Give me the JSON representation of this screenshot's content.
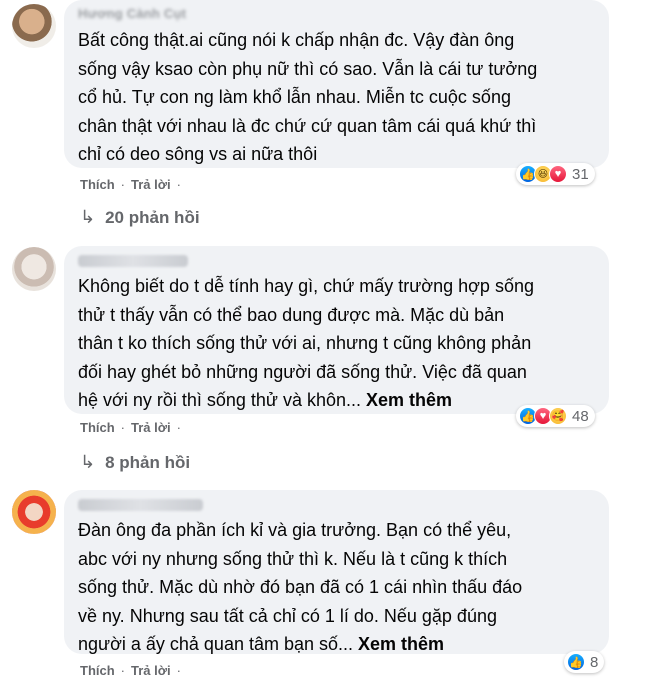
{
  "comments": [
    {
      "author": "Hương Cành Cụt",
      "text": "Bất công thật.ai cũng nói k chấp nhận đc. Vậy đàn ông\nsống vậy ksao còn phụ nữ thì có sao. Vẫn là cái tư tưởng\ncổ hủ. Tự con ng làm khổ lẫn nhau. Miễn tc cuộc sống\nchân thật với nhau là đc chứ cứ quan tâm cái quá khứ thì\nchỉ có deo sông vs ai nữa thôi",
      "see_more": "",
      "reaction_icons": [
        "like-icon",
        "haha-icon",
        "love-icon"
      ],
      "reaction_count": "31",
      "like_label": "Thích",
      "reply_label": "Trả lời",
      "replies_label": "20 phản hồi"
    },
    {
      "author": "",
      "text": "Không biết do t dễ tính hay gì, chứ mấy trường hợp sống\nthử t thấy vẫn có thể bao dung được mà. Mặc dù bản\nthân t ko thích sống thử với ai, nhưng t cũng không phản\nđối hay ghét bỏ những người đã sống thử. Việc đã quan\nhệ với ny rồi thì sống thử và khôn... ",
      "see_more": "Xem thêm",
      "reaction_icons": [
        "like-icon",
        "love-icon",
        "care-icon"
      ],
      "reaction_count": "48",
      "like_label": "Thích",
      "reply_label": "Trả lời",
      "replies_label": "8 phản hồi"
    },
    {
      "author": "",
      "text": "Đàn ông đa phần ích kỉ và gia trưởng. Bạn có thể yêu,\nabc với ny nhưng sống thử thì k. Nếu là t cũng k thích\nsống thử. Mặc dù nhờ đó bạn đã có 1 cái nhìn thấu đáo\nvề ny. Nhưng sau tất cả chỉ có 1 lí do. Nếu gặp đúng\nngười a ấy chả quan tâm bạn số... ",
      "see_more": "Xem thêm",
      "reaction_icons": [
        "like-icon"
      ],
      "reaction_count": "8",
      "like_label": "Thích",
      "reply_label": "Trả lời",
      "replies_label": ""
    }
  ],
  "colors": {
    "bubble": "#f0f2f5",
    "meta_text": "#65676b",
    "like_blue": "#0062df",
    "love_red": "#e61739"
  }
}
